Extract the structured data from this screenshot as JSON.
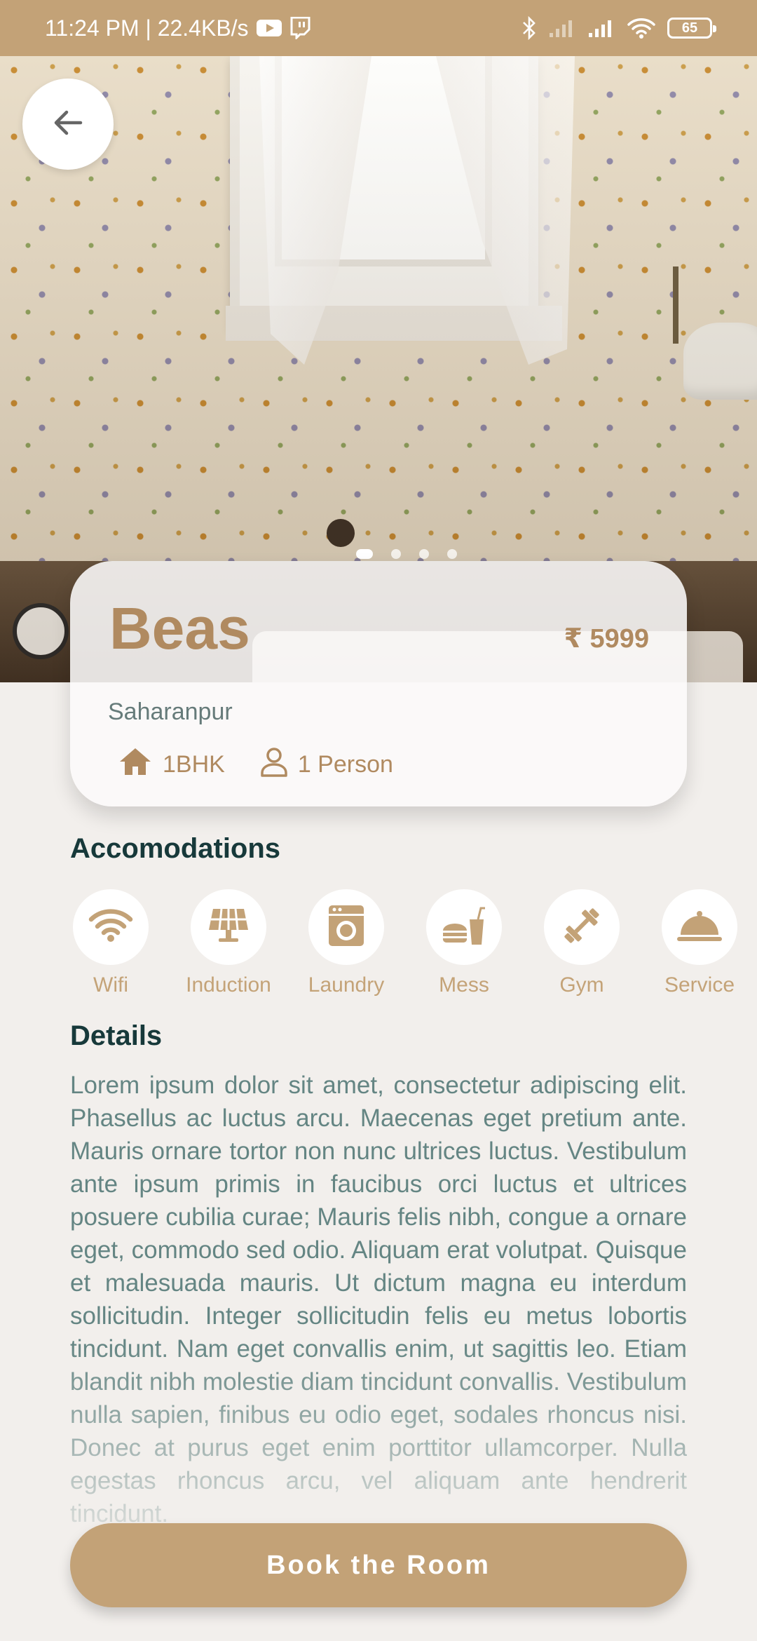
{
  "status_bar": {
    "time_speed": "11:24 PM | 22.4KB/s",
    "battery": "65"
  },
  "hero": {
    "image_pages": 4,
    "active_page": 1
  },
  "room": {
    "name": "Beas",
    "price": "₹ 5999",
    "location": "Saharanpur",
    "type": "1BHK",
    "occupancy": "1 Person"
  },
  "sections": {
    "accommodations_title": "Accomodations",
    "details_title": "Details"
  },
  "amenities": [
    {
      "label": "Wifi",
      "icon": "wifi-icon"
    },
    {
      "label": "Induction",
      "icon": "induction-icon"
    },
    {
      "label": "Laundry",
      "icon": "laundry-icon"
    },
    {
      "label": "Mess",
      "icon": "mess-icon"
    },
    {
      "label": "Gym",
      "icon": "gym-icon"
    },
    {
      "label": "Service",
      "icon": "service-bell-icon"
    }
  ],
  "details_text": "Lorem ipsum dolor sit amet, consectetur adipiscing elit. Phasellus ac luctus arcu. Maecenas eget pretium ante. Mauris ornare tortor non nunc ultrices luctus. Vestibulum ante ipsum primis in faucibus orci luctus et ultrices posuere cubilia curae; Mauris felis nibh, congue a ornare eget, commodo sed odio. Aliquam erat volutpat. Quisque et malesuada mauris. Ut dictum magna eu interdum sollicitudin. Integer sollicitudin felis eu metus lobortis tincidunt. Nam eget convallis enim, ut sagittis leo. Etiam blandit nibh molestie diam tincidunt convallis. Vestibulum nulla sapien, finibus eu odio eget, sodales rhoncus nisi. Donec at purus eget enim porttitor ullamcorper. Nulla egestas rhoncus arcu, vel aliquam ante hendrerit tincidunt.",
  "actions": {
    "book_label": "Book the Room"
  },
  "colors": {
    "accent": "#c3a277",
    "heading": "#17393a",
    "body_text": "#648583",
    "background": "#f2efec"
  }
}
